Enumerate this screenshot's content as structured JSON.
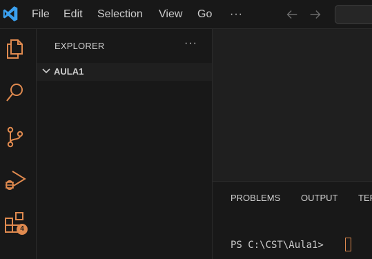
{
  "titlebar": {
    "logo_icon": "vscode-logo-icon",
    "menu": [
      "File",
      "Edit",
      "Selection",
      "View",
      "Go",
      "···"
    ],
    "back_icon": "arrow-left-icon",
    "forward_icon": "arrow-right-icon"
  },
  "activity_bar": {
    "items": [
      "explorer-icon",
      "search-icon",
      "source-control-icon",
      "run-debug-icon",
      "extensions-icon"
    ],
    "extensions_badge": "4",
    "accent_color": "#e08a4f"
  },
  "sidebar": {
    "title": "EXPLORER",
    "more": "···",
    "folder": "AULA1"
  },
  "panel": {
    "tabs": [
      "PROBLEMS",
      "OUTPUT",
      "TER"
    ],
    "prompt": "PS C:\\CST\\Aula1> "
  }
}
